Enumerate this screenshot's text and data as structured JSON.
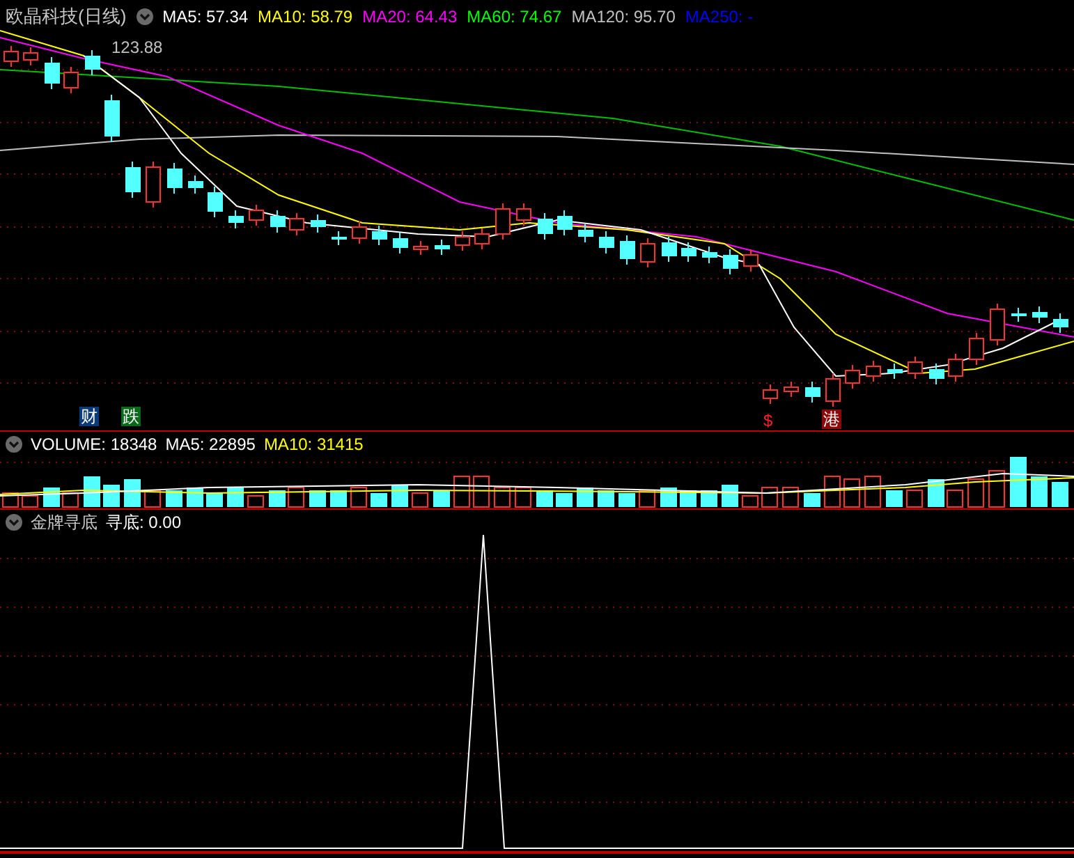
{
  "main_pane": {
    "title": "欧晶科技(日线)",
    "indicators": [
      {
        "label": "MA5: 57.34",
        "color": "#ffffff"
      },
      {
        "label": "MA10: 58.79",
        "color": "#ffff00"
      },
      {
        "label": "MA20: 64.43",
        "color": "#ff00ff"
      },
      {
        "label": "MA60: 74.67",
        "color": "#00ff00"
      },
      {
        "label": "MA120: 95.70",
        "color": "#c0c0c0"
      },
      {
        "label": "MA250: -",
        "color": "#0000ff"
      }
    ],
    "price_label": "123.88",
    "markers": [
      {
        "text": "财",
        "kind": "finance"
      },
      {
        "text": "跌",
        "kind": "drop"
      },
      {
        "text": "$",
        "kind": "dollar"
      },
      {
        "text": "港",
        "kind": "hk"
      }
    ]
  },
  "volume_pane": {
    "indicators": [
      {
        "label": "VOLUME: 18348",
        "color": "#ffffff"
      },
      {
        "label": "MA5: 22895",
        "color": "#ffffff"
      },
      {
        "label": "MA10: 31415",
        "color": "#ffff00"
      }
    ]
  },
  "signal_pane": {
    "title": "金牌寻底",
    "indicators": [
      {
        "label": "寻底: 0.00",
        "color": "#ffffff"
      }
    ]
  }
}
